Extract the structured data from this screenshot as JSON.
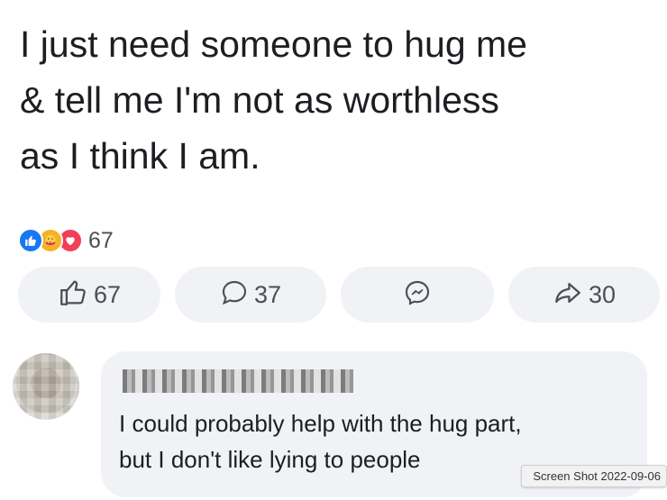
{
  "post": {
    "text": "I just need someone to hug me\n& tell me I'm not as worthless\nas I think I am."
  },
  "reactions": {
    "icons": [
      "like-icon",
      "care-icon",
      "love-icon"
    ],
    "count": "67"
  },
  "actions": {
    "like": {
      "icon": "thumbs-up-icon",
      "count": "67"
    },
    "comment": {
      "icon": "comment-bubble-icon",
      "count": "37"
    },
    "messenger": {
      "icon": "messenger-icon"
    },
    "share": {
      "icon": "share-arrow-icon",
      "count": "30"
    }
  },
  "comment": {
    "author_name": "",
    "text": "I could probably help with the hug part,\nbut I don't like lying to people"
  },
  "overlay": {
    "screenshot_label": "Screen Shot 2022-09-06"
  },
  "colors": {
    "like_blue": "#1877f2",
    "love_red": "#f33e58",
    "care_yellow": "#f7b125",
    "button_bg": "#f0f2f5"
  }
}
